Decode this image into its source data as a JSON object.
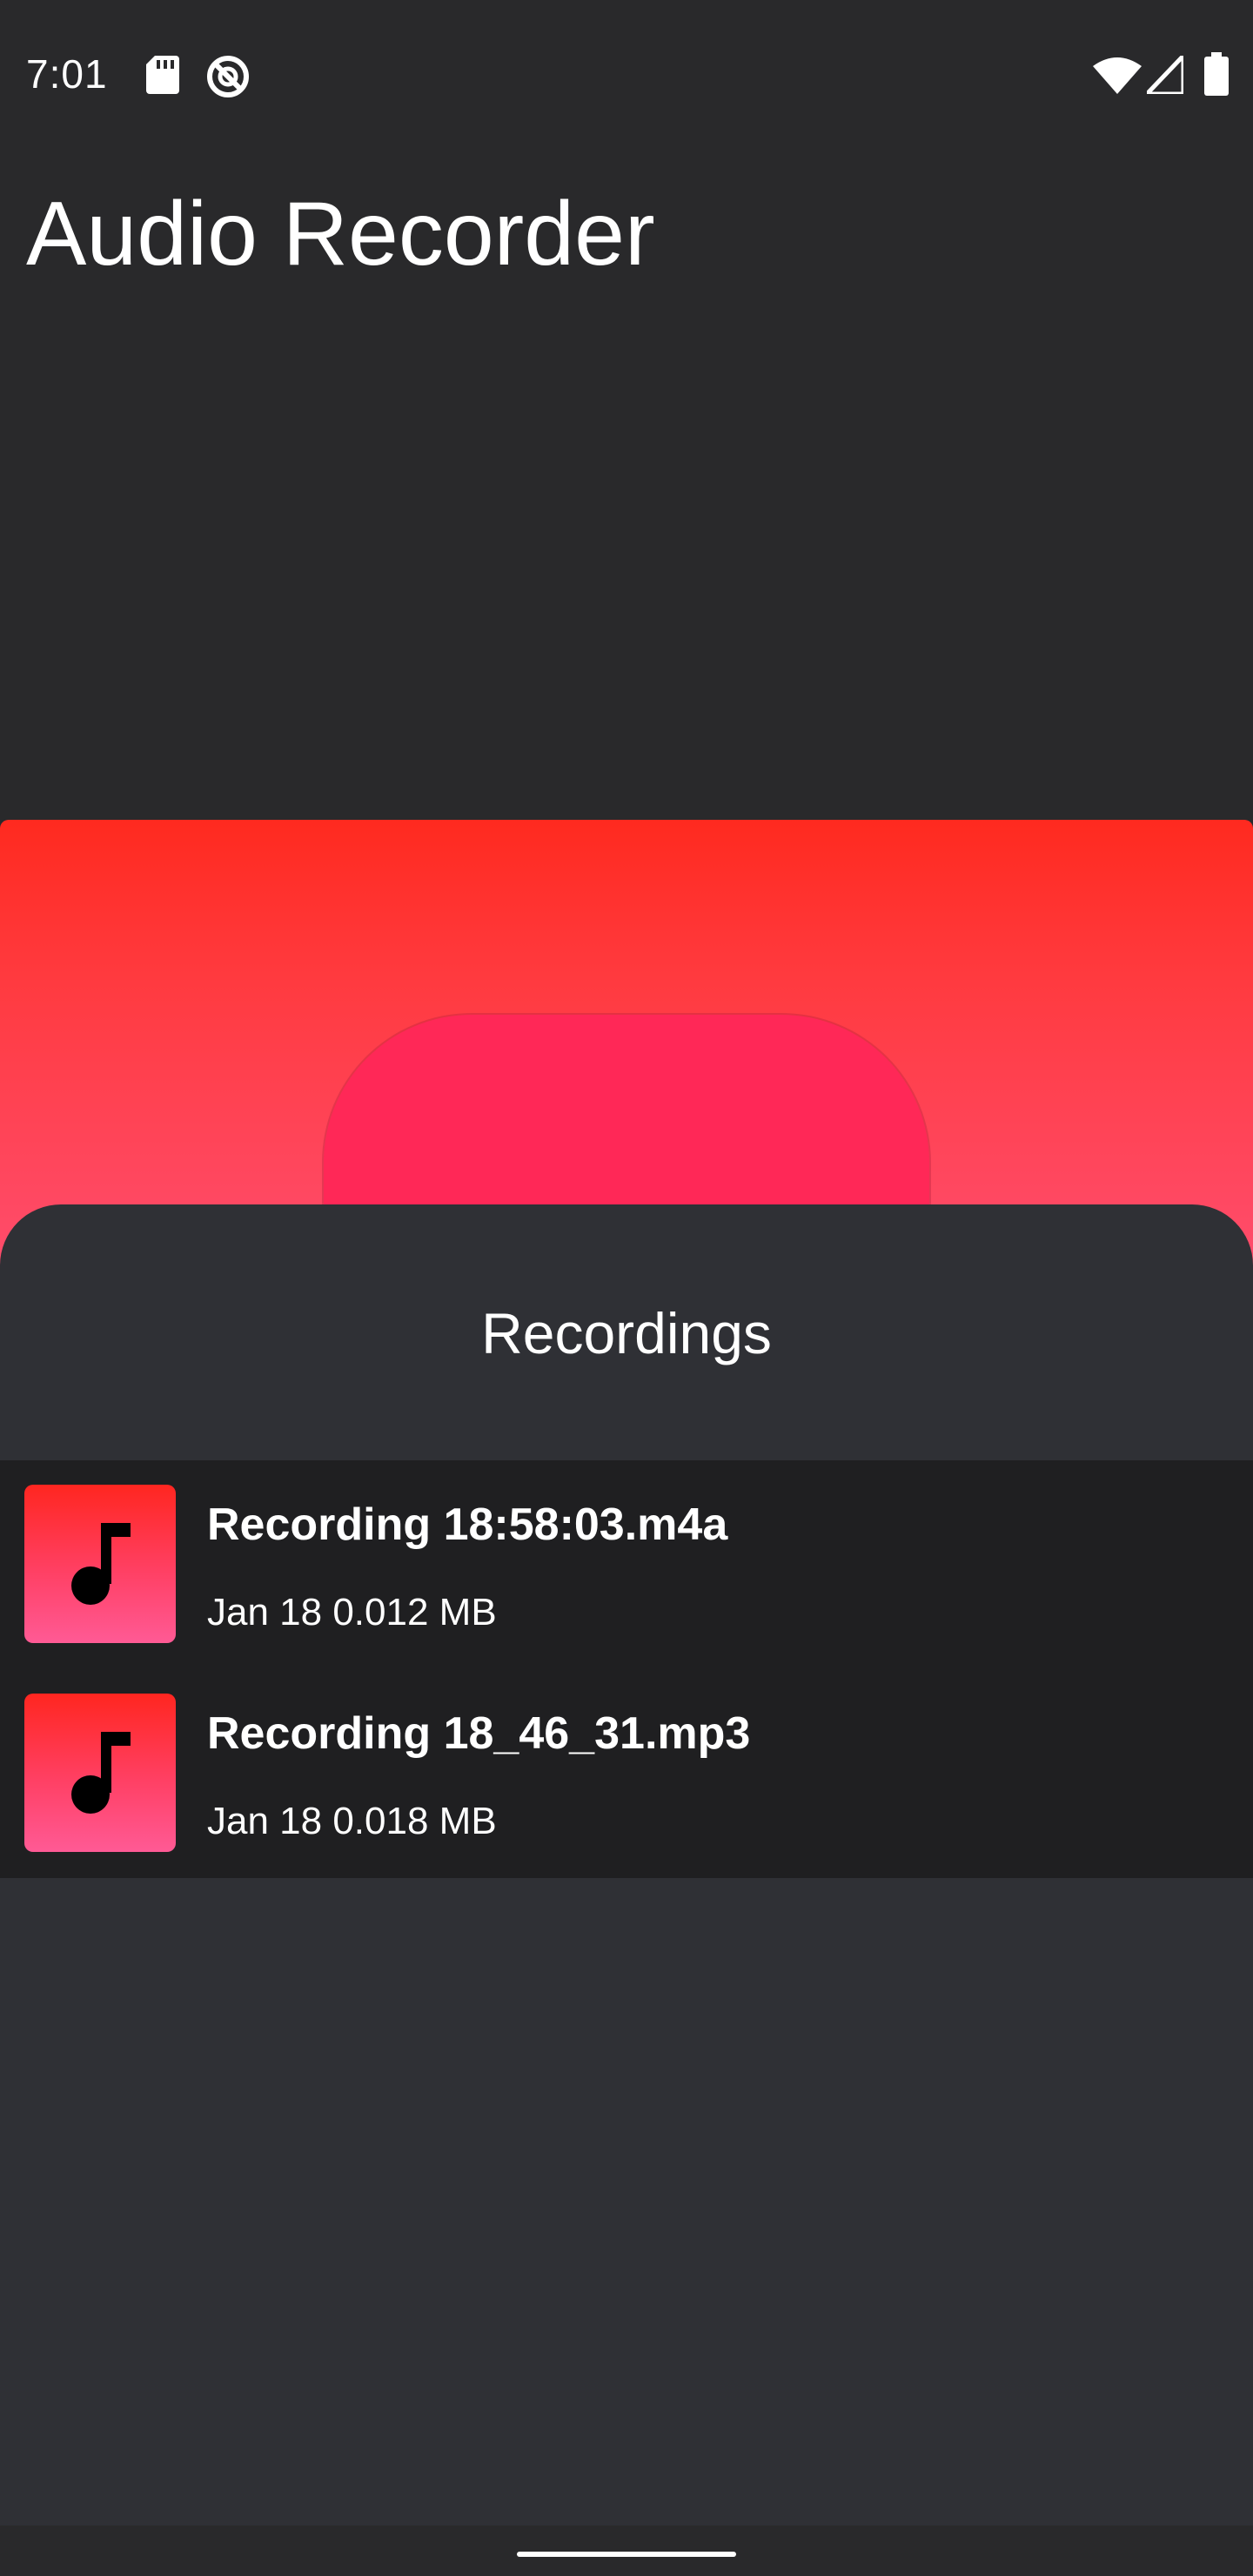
{
  "status_bar": {
    "time": "7:01",
    "left_icons": [
      "sd-card-icon",
      "do-not-disturb-icon"
    ],
    "right_icons": [
      "wifi-icon",
      "cellular-signal-icon",
      "battery-icon"
    ]
  },
  "app": {
    "title": "Audio Recorder"
  },
  "recorder": {
    "record_button_icon": "record-button"
  },
  "recordings_sheet": {
    "title": "Recordings",
    "items": [
      {
        "name": "Recording 18:58:03.m4a",
        "meta": "Jan 18 0.012 MB",
        "icon": "music-note-icon"
      },
      {
        "name": "Recording 18_46_31.mp3",
        "meta": "Jan 18 0.018 MB",
        "icon": "music-note-icon"
      }
    ]
  },
  "colors": {
    "background": "#29292b",
    "sheet": "#2f3035",
    "list": "#1f1f21",
    "accent_top": "#ff2a1f",
    "accent_bottom": "#ff4d6d",
    "record_button": "#ff2857"
  }
}
